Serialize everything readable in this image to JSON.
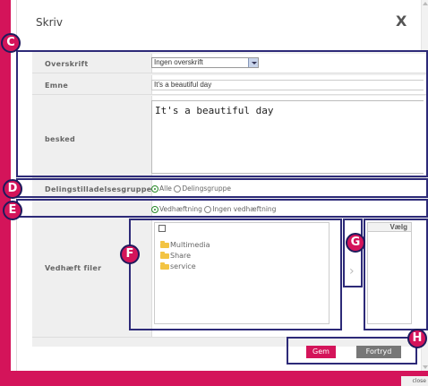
{
  "dialog": {
    "title": "Skriv",
    "close_label": "X"
  },
  "form": {
    "subject_type": {
      "label": "Overskrift",
      "selected": "Ingen overskrift"
    },
    "subject": {
      "label": "Emne",
      "value": "It's a beautiful day"
    },
    "message": {
      "label": "besked",
      "value": "It's a beautiful day"
    },
    "sharing": {
      "label": "Delingstilladelsesgruppe",
      "options": [
        "Alle",
        "Delingsgruppe"
      ],
      "selected": "Alle"
    },
    "attachment_mode": {
      "options": [
        "Vedhæftning",
        "Ingen vedhæftning"
      ],
      "selected": "Vedhæftning"
    },
    "attachments": {
      "label": "Vedhæft filer",
      "folders": [
        "Multimedia",
        "Share",
        "service"
      ],
      "selected_header": "Vælg"
    }
  },
  "buttons": {
    "save": "Gem",
    "cancel": "Fortryd"
  },
  "footer": {
    "close_text": "close"
  },
  "markers": [
    "C",
    "D",
    "E",
    "F",
    "G",
    "H"
  ],
  "colors": {
    "accent": "#d4145a",
    "outline": "#2d2a78",
    "cancel_bg": "#777777"
  }
}
